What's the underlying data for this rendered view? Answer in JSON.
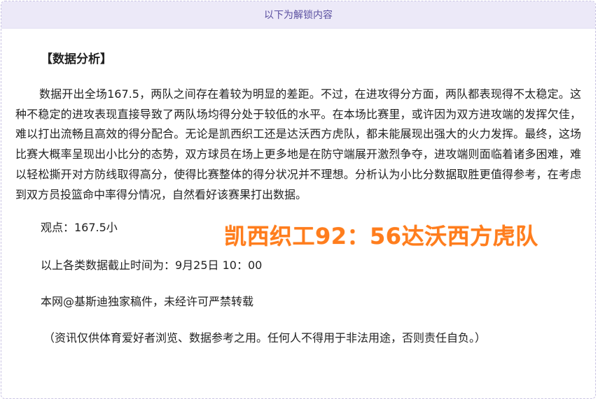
{
  "header": {
    "unlock_text": "以下为解锁内容"
  },
  "article": {
    "section_title": "【数据分析】",
    "paragraph": "数据开出全场167.5，两队之间存在着较为明显的差距。不过，在进攻得分方面，两队都表现得不太稳定。这种不稳定的进攻表现直接导致了两队场均得分处于较低的水平。在本场比赛里，或许因为双方进攻端的发挥欠佳，难以打出流畅且高效的得分配合。无论是凯西织工还是达沃西方虎队，都未能展现出强大的火力发挥。最终，这场比赛大概率呈现出小比分的态势，双方球员在场上更多地是在防守端展开激烈争夺，进攻端则面临着诸多困难，难以轻松撕开对方防线取得高分，使得比赛整体的得分状况并不理想。分析认为小比分数据取胜更值得参考，在考虑到双方员投篮命中率得分情况，自然看好该赛果打出数据。",
    "viewpoint": "观点：167.5小",
    "cutoff": "以上各类数据截止时间为：9月25日 10：00",
    "copyright": "本网@基斯迪独家稿件，未经许可严禁转载",
    "disclaimer": "（资讯仅供体育爱好者浏览、数据参考之用。任何人不得用于非法用途，否则责任自负。）"
  },
  "score_overlay": {
    "text": "凯西织工92：56达沃西方虎队",
    "color": "#ff7d1d"
  }
}
